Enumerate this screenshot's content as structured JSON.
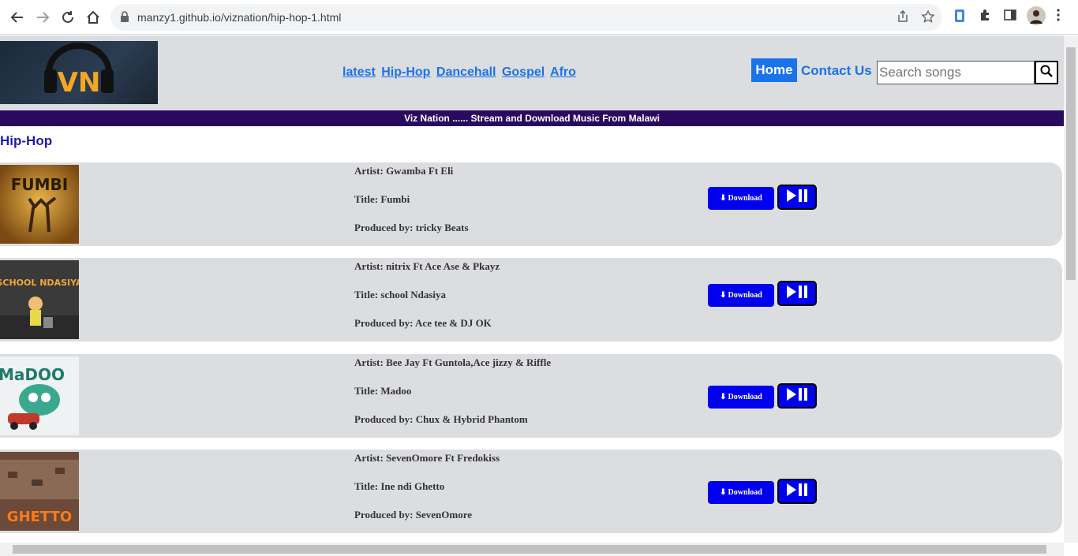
{
  "browser": {
    "url": "manzy1.github.io/viznation/hip-hop-1.html"
  },
  "header": {
    "logo_text": "VN",
    "nav": [
      "latest",
      "Hip-Hop",
      "Dancehall",
      "Gospel",
      "Afro"
    ],
    "home_label": "Home",
    "contact_label": "Contact Us",
    "search_placeholder": "Search songs"
  },
  "banner": "Viz Nation ...... Stream and Download Music From Malawi",
  "section_title": "Hip-Hop",
  "songs": [
    {
      "artist": "Artist: Gwamba Ft Eli",
      "title": "Title: Fumbi",
      "producer": "Produced by: tricky Beats",
      "art_text": "FUMBI",
      "download": "Download"
    },
    {
      "artist": "Artist: nitrix Ft Ace Ase & Pkayz",
      "title": "Title: school Ndasiya",
      "producer": "Produced by: Ace tee & DJ OK",
      "art_text": "SCHOOL NDASIYA",
      "download": "Download"
    },
    {
      "artist": "Artist: Bee Jay Ft Guntola,Ace jizzy & Riffle",
      "title": "Title: Madoo",
      "producer": "Produced by: Chux & Hybrid Phantom",
      "art_text": "MaDOO",
      "download": "Download"
    },
    {
      "artist": "Artist: SevenOmore Ft Fredokiss",
      "title": "Title: Ine ndi Ghetto",
      "producer": "Produced by: SevenOmore",
      "art_text": "GHETTO",
      "download": "Download"
    }
  ],
  "colors": {
    "link": "#1a73e8",
    "banner": "#2a0a5e",
    "button": "#0000ee",
    "card": "#dcdde0"
  }
}
